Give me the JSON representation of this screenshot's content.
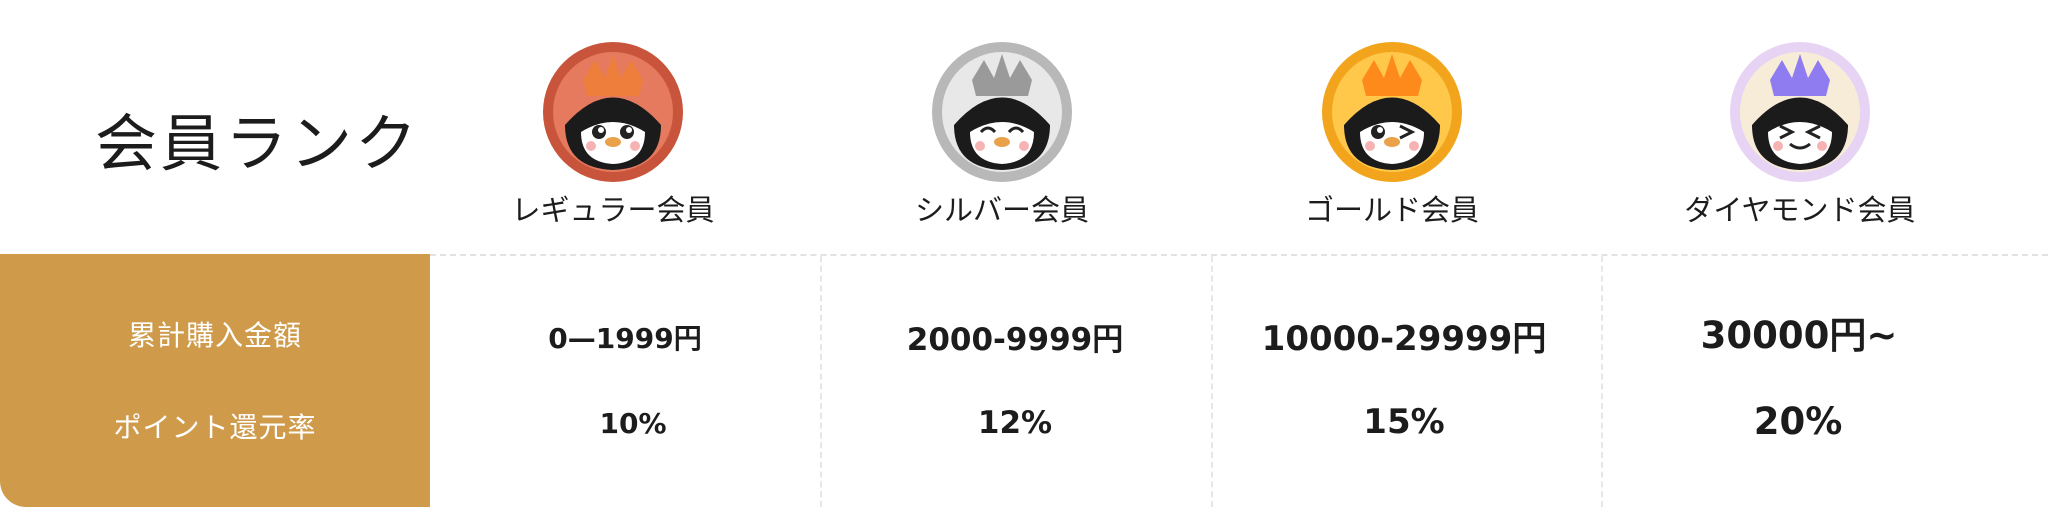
{
  "title": "会員ランク",
  "row_labels": {
    "purchase": "累計購入金額",
    "point_rate": "ポイント還元率"
  },
  "ranks": [
    {
      "name": "レギュラー会員",
      "purchase": "0—1999円",
      "point_rate": "10%",
      "badge_color": "#c8553b",
      "crown_color": "#ee7e3b"
    },
    {
      "name": "シルバー会員",
      "purchase": "2000-9999円",
      "point_rate": "12%",
      "badge_color": "#b8b8b8",
      "crown_color": "#9a9a9a"
    },
    {
      "name": "ゴールド会員",
      "purchase": "10000-29999円",
      "point_rate": "15%",
      "badge_color": "#f2a51c",
      "crown_color": "#ff8a1c"
    },
    {
      "name": "ダイヤモンド会員",
      "purchase": "30000円~",
      "point_rate": "20%",
      "badge_color": "#e7d4f4",
      "crown_color": "#8f7cf0"
    }
  ],
  "colors": {
    "sidebar": "#cf9b4b",
    "text": "#1c1c1c"
  }
}
